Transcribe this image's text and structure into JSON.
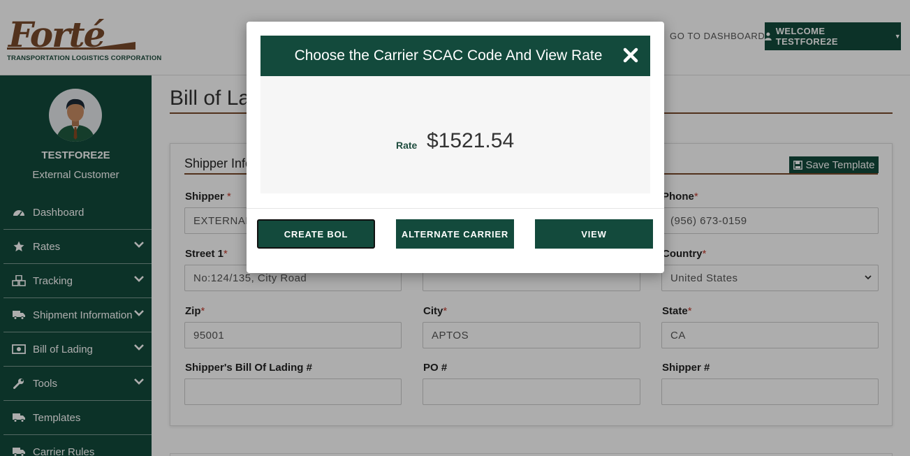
{
  "header": {
    "logo_word": "Forté",
    "logo_sub": "TRANSPORTATION LOGISTICS CORPORATION",
    "go_to_dashboard": "GO TO DASHBOARD",
    "welcome": "WELCOME TESTFORE2E"
  },
  "sidebar": {
    "user_name": "TESTFORE2E",
    "user_role": "External Customer",
    "items": [
      {
        "label": "Dashboard",
        "icon": "gauge-icon",
        "expandable": false
      },
      {
        "label": "Rates",
        "icon": "star-icon",
        "expandable": true
      },
      {
        "label": "Tracking",
        "icon": "cubes-icon",
        "expandable": true
      },
      {
        "label": "Shipment Information",
        "icon": "truck-icon",
        "expandable": true
      },
      {
        "label": "Bill of Lading",
        "icon": "money-bill-icon",
        "expandable": true
      },
      {
        "label": "Tools",
        "icon": "wrench-icon",
        "expandable": true
      },
      {
        "label": "Templates",
        "icon": "truck-icon",
        "expandable": false
      },
      {
        "label": "Carrier Rules",
        "icon": "truck-icon",
        "expandable": false
      }
    ]
  },
  "page": {
    "title": "Bill of La",
    "section_title": "Shipper Info",
    "save_template": "Save Template",
    "fields": {
      "shipper": {
        "label": "Shipper",
        "value": "EXTERNAL"
      },
      "phone": {
        "label": "Phone",
        "value": "(956) 673-0159"
      },
      "street1": {
        "label": "Street 1",
        "value": "No:124/135, City Road"
      },
      "country": {
        "label": "Country",
        "value": "United States"
      },
      "zip": {
        "label": "Zip",
        "value": "95001"
      },
      "city": {
        "label": "City",
        "value": "APTOS"
      },
      "state": {
        "label": "State",
        "value": "CA"
      },
      "shipper_bol": {
        "label": "Shipper's Bill Of Lading #",
        "value": ""
      },
      "po": {
        "label": "PO #",
        "value": ""
      },
      "shipper_no": {
        "label": "Shipper #",
        "value": ""
      }
    }
  },
  "modal": {
    "title": "Choose the Carrier SCAC Code And View Rate",
    "rate_label": "Rate",
    "rate_value": "$1521.54",
    "buttons": {
      "create_bol": "CREATE BOL",
      "alternate_carrier": "ALTERNATE CARRIER",
      "view": "VIEW"
    }
  },
  "colors": {
    "brand_green": "#134a3c",
    "brand_brown": "#7a4a2c",
    "required": "#c0392b"
  }
}
